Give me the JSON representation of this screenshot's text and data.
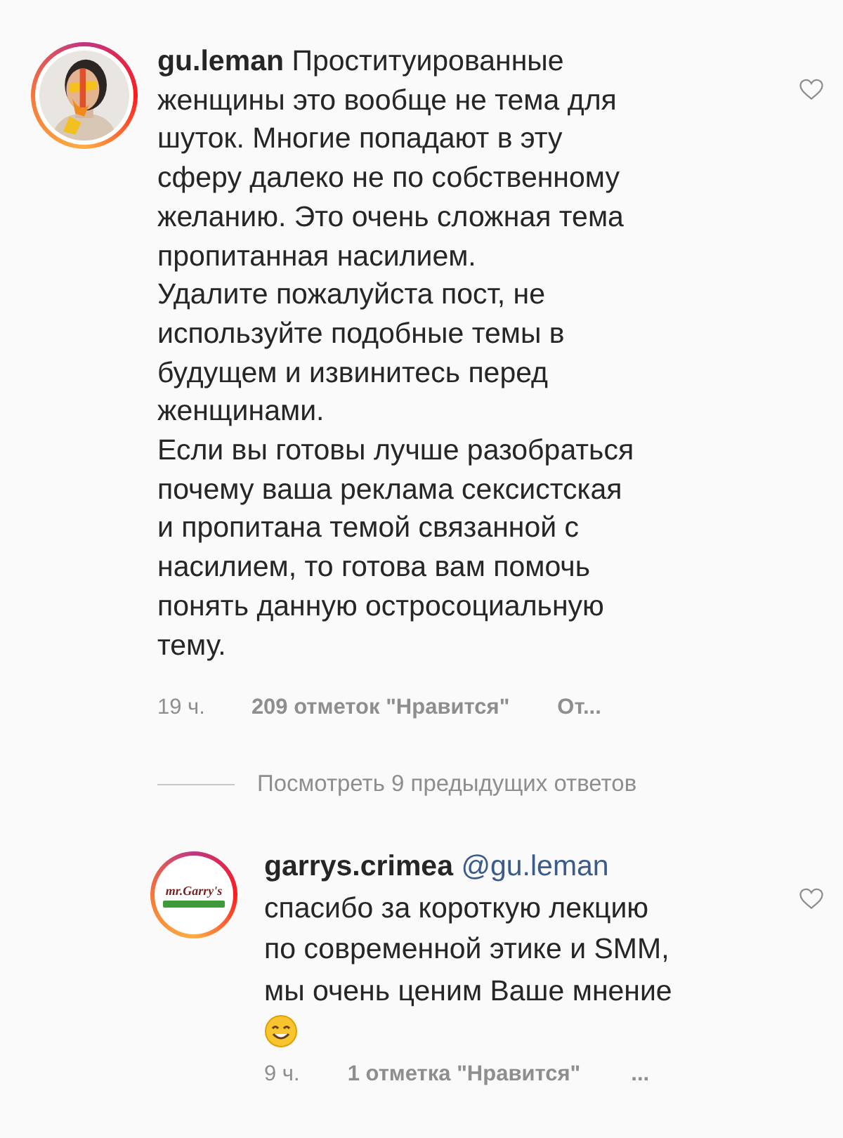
{
  "comment": {
    "username": "gu.leman",
    "liked": false,
    "lines": [
      "Проституированные",
      "женщины это вообще не тема для",
      "шуток. Многие попадают в эту",
      "сферу далеко не по собственному",
      "желанию. Это очень сложная тема",
      "пропитанная насилием.",
      "Удалите пожалуйста пост, не",
      "используйте подобные темы в",
      "будущем и извинитесь перед",
      "женщинами.",
      "Если вы готовы лучше разобраться",
      "почему ваша реклама сексистская",
      "и пропитана темой связанной с",
      "насилием, то готова вам помочь",
      "понять данную остросоциальную",
      "тему."
    ],
    "time": "19 ч.",
    "likes": "209 отметок \"Нравится\"",
    "action": "От..."
  },
  "view_replies": "Посмотреть 9 предыдущих ответов",
  "reply": {
    "username": "garrys.crimea",
    "avatar_logo": "mr.Garry's",
    "mention": "@gu.leman",
    "liked": false,
    "lines": [
      "спасибо за короткую лекцию",
      "по современной этике и SMM,",
      "мы очень ценим Ваше мнение"
    ],
    "time": "9 ч.",
    "likes": "1 отметка \"Нравится\"",
    "action": "..."
  }
}
